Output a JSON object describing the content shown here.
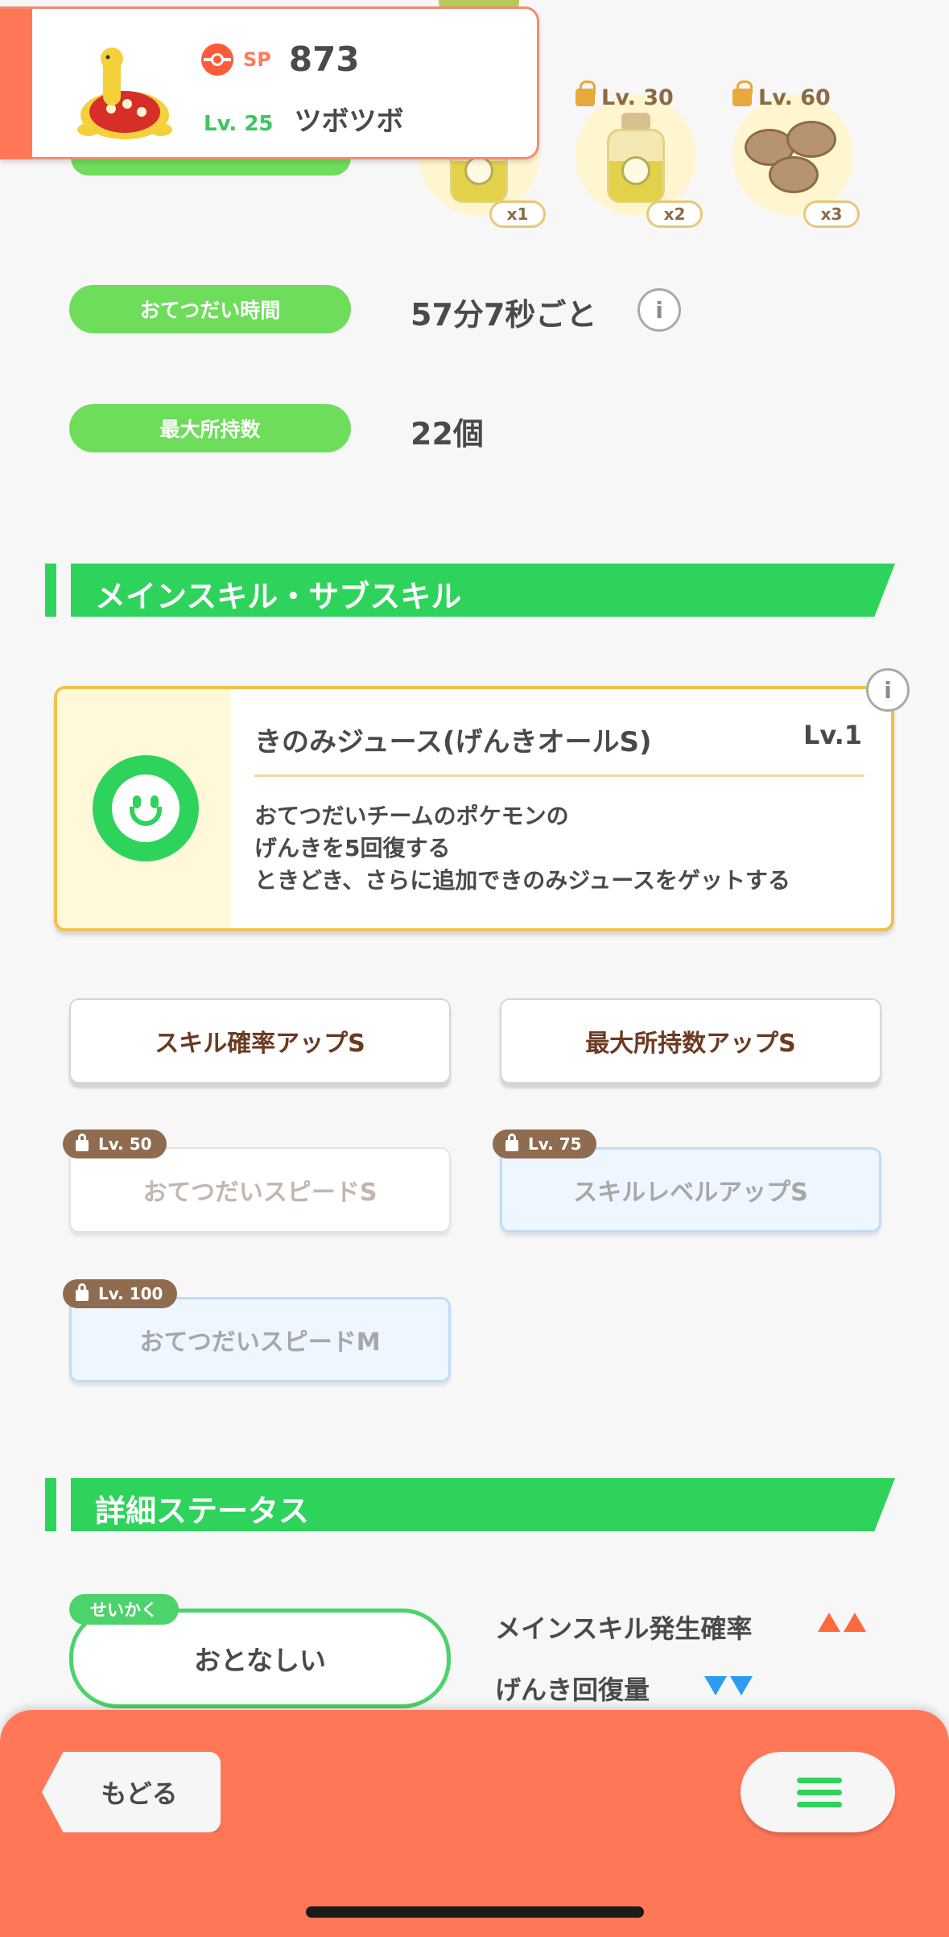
{
  "pokemon": {
    "sp_label": "SP",
    "sp_value": "873",
    "level": "Lv. 25",
    "name": "ツボツボ"
  },
  "ingredients": [
    {
      "lock": "",
      "count": "x1"
    },
    {
      "lock": "Lv. 30",
      "count": "x2"
    },
    {
      "lock": "Lv. 60",
      "count": "x3"
    }
  ],
  "info": {
    "help_time_label": "おてつだい時間",
    "help_time_value": "57分7秒ごと",
    "max_carry_label": "最大所持数",
    "max_carry_value": "22個"
  },
  "skills_section": {
    "title": "メインスキル・サブスキル",
    "main_skill": {
      "name": "きのみジュース(げんきオールS)",
      "level": "Lv.1",
      "desc_1": "おてつだいチームのポケモンの",
      "desc_2": "げんきを5回復する",
      "desc_3": "ときどき、さらに追加できのみジュースをゲットする"
    },
    "sub_skills": [
      {
        "label": "スキル確率アップS",
        "lock": ""
      },
      {
        "label": "最大所持数アップS",
        "lock": ""
      },
      {
        "label": "おてつだいスピードS",
        "lock": "Lv. 50"
      },
      {
        "label": "スキルレベルアップS",
        "lock": "Lv. 75"
      },
      {
        "label": "おてつだいスピードM",
        "lock": "Lv. 100"
      }
    ]
  },
  "detail_section": {
    "title": "詳細ステータス",
    "nature_tag": "せいかく",
    "nature": "おとなしい",
    "up_stat": "メインスキル発生確率",
    "down_stat": "げんき回復量"
  },
  "nav": {
    "back_label": "もどる"
  },
  "colors": {
    "accent_green": "#2ed35c",
    "accent_orange": "#ff7757",
    "lock_brown": "#8f6b4f",
    "up_arrow": "#ff6a3d",
    "down_arrow": "#2c9bf0"
  }
}
